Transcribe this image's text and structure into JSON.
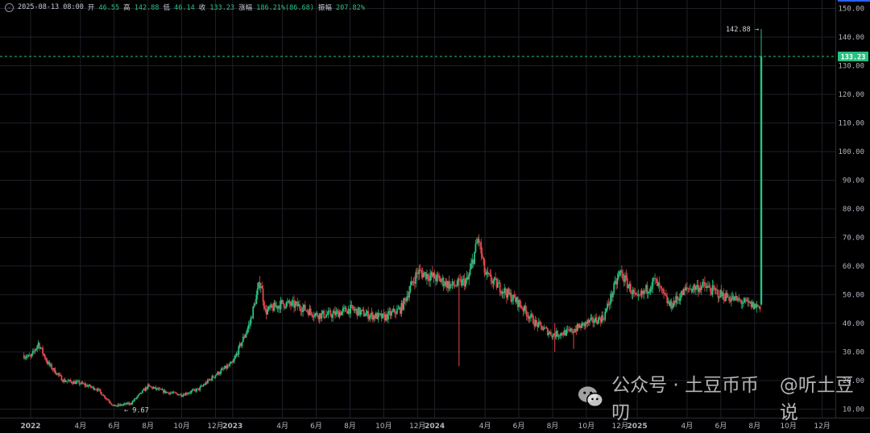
{
  "ohlc": {
    "date": "2025-08-13 08:00",
    "open_label": "开",
    "open": "46.55",
    "high_label": "高",
    "high": "142.88",
    "low_label": "低",
    "low": "46.14",
    "close_label": "收",
    "close": "133.23",
    "change_label": "涨幅",
    "change": "186.21%(86.68)",
    "amplitude_label": "振幅",
    "amplitude": "207.82%"
  },
  "watermark": {
    "text1": "公众号 · 土豆币币叨",
    "text2": "@听土豆说",
    "icon": "wechat-icon"
  },
  "colors": {
    "background": "#000000",
    "grid": "#1e2029",
    "up": "#26c281",
    "down": "#e5484d",
    "axis_text": "#b2b5be",
    "price_line": "#26c281"
  },
  "chart_data": {
    "type": "candlestick",
    "title": "",
    "x_ticks": [
      "2022",
      "4月",
      "6月",
      "8月",
      "10月",
      "12月",
      "2023",
      "4月",
      "6月",
      "8月",
      "10月",
      "12月",
      "2024",
      "4月",
      "6月",
      "8月",
      "10月",
      "12月",
      "2025",
      "4月",
      "6月",
      "8月",
      "10月",
      "12月"
    ],
    "y_ticks": [
      "10.00",
      "20.00",
      "30.00",
      "40.00",
      "50.00",
      "60.00",
      "70.00",
      "80.00",
      "90.00",
      "100.00",
      "110.00",
      "120.00",
      "130.00",
      "140.00",
      "150.00"
    ],
    "ylim": [
      7,
      151
    ],
    "current_price": 133.23,
    "current_price_label": "133.23",
    "annotations": {
      "high": {
        "value": 142.88,
        "label": "142.88"
      },
      "low": {
        "value": 9.67,
        "label": "9.67"
      }
    },
    "series_points": [
      [
        "2021-12",
        30
      ],
      [
        "2022-01",
        28
      ],
      [
        "2022-01-15",
        33
      ],
      [
        "2022-02",
        26
      ],
      [
        "2022-03",
        20
      ],
      [
        "2022-04",
        19
      ],
      [
        "2022-05",
        17
      ],
      [
        "2022-06",
        11
      ],
      [
        "2022-07",
        12
      ],
      [
        "2022-08",
        18
      ],
      [
        "2022-09",
        16
      ],
      [
        "2022-10",
        15
      ],
      [
        "2022-11",
        17
      ],
      [
        "2022-12",
        22
      ],
      [
        "2023-01",
        26
      ],
      [
        "2023-02",
        40
      ],
      [
        "2023-02-20",
        55
      ],
      [
        "2023-03",
        44
      ],
      [
        "2023-04",
        47
      ],
      [
        "2023-05",
        46
      ],
      [
        "2023-06",
        43
      ],
      [
        "2023-07",
        43
      ],
      [
        "2023-08",
        45
      ],
      [
        "2023-09",
        43
      ],
      [
        "2023-10",
        42
      ],
      [
        "2023-11",
        45
      ],
      [
        "2023-12",
        58
      ],
      [
        "2024-01",
        56
      ],
      [
        "2024-02",
        53
      ],
      [
        "2024-03",
        55
      ],
      [
        "2024-03-20",
        70
      ],
      [
        "2024-04",
        57
      ],
      [
        "2024-05",
        52
      ],
      [
        "2024-06",
        47
      ],
      [
        "2024-07",
        40
      ],
      [
        "2024-08",
        36
      ],
      [
        "2024-09",
        37
      ],
      [
        "2024-10",
        40
      ],
      [
        "2024-11",
        42
      ],
      [
        "2024-12",
        58
      ],
      [
        "2025-01",
        48
      ],
      [
        "2025-02",
        55
      ],
      [
        "2025-03",
        46
      ],
      [
        "2025-04",
        52
      ],
      [
        "2025-05",
        53
      ],
      [
        "2025-06",
        50
      ],
      [
        "2025-07",
        48
      ],
      [
        "2025-08",
        46
      ]
    ],
    "last_candle": {
      "date": "2025-08-13",
      "open": 46.55,
      "high": 142.88,
      "low": 46.14,
      "close": 133.23
    }
  }
}
